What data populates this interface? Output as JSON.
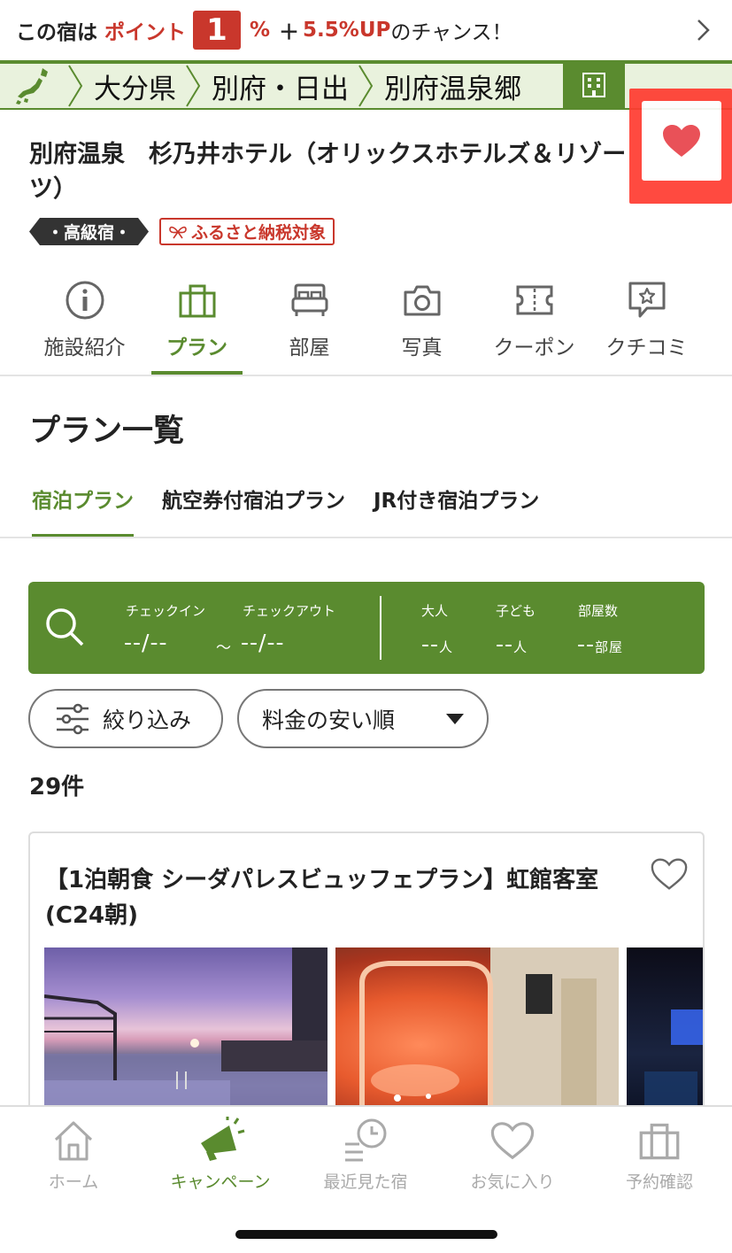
{
  "point_banner": {
    "prefix": "この宿は",
    "point_label": "ポイント",
    "point_value": "1",
    "percent": "%",
    "plus": "＋",
    "bonus": "5.5%UP",
    "suffix": "のチャンス！"
  },
  "breadcrumb": {
    "items": [
      "大分県",
      "別府・日出",
      "別府温泉郷"
    ]
  },
  "hotel": {
    "name": "別府温泉　杉乃井ホテル（オリックスホテルズ＆リゾーツ）",
    "tag_class": "・高級宿・",
    "tag_furusato": "ふるさと納税対象"
  },
  "icon_tabs": [
    {
      "label": "施設紹介",
      "icon": "info-icon"
    },
    {
      "label": "プラン",
      "icon": "bag-icon"
    },
    {
      "label": "部屋",
      "icon": "bed-icon"
    },
    {
      "label": "写真",
      "icon": "camera-icon"
    },
    {
      "label": "クーポン",
      "icon": "coupon-icon"
    },
    {
      "label": "クチコミ",
      "icon": "review-icon"
    }
  ],
  "plan_heading": "プラン一覧",
  "plan_tabs": [
    "宿泊プラン",
    "航空券付宿泊プラン",
    "JR付き宿泊プラン"
  ],
  "search": {
    "checkin_label": "チェックイン",
    "checkin_value": "--/--",
    "tilde": "～",
    "checkout_label": "チェックアウト",
    "checkout_value": "--/--",
    "adult_label": "大人",
    "adult_value": "--",
    "adult_unit": "人",
    "child_label": "子ども",
    "child_value": "--",
    "child_unit": "人",
    "rooms_label": "部屋数",
    "rooms_value": "--",
    "rooms_unit": "部屋"
  },
  "filters": {
    "filter_label": "絞り込み",
    "sort_label": "料金の安い順"
  },
  "result_count": "29件",
  "plan_card": {
    "title": "【1泊朝食 シーダパレスビュッフェプラン】虹館客室(C24朝)"
  },
  "bottom_nav": [
    {
      "label": "ホーム",
      "icon": "home-icon"
    },
    {
      "label": "キャンペーン",
      "icon": "megaphone-icon"
    },
    {
      "label": "最近見た宿",
      "icon": "history-icon"
    },
    {
      "label": "お気に入り",
      "icon": "heart-outline-icon"
    },
    {
      "label": "予約確認",
      "icon": "bag-icon"
    }
  ],
  "colors": {
    "brand_green": "#5a8b2f",
    "accent_red": "#c9372c",
    "highlight_red": "#ff3b30",
    "heart_red": "#e8434a"
  }
}
